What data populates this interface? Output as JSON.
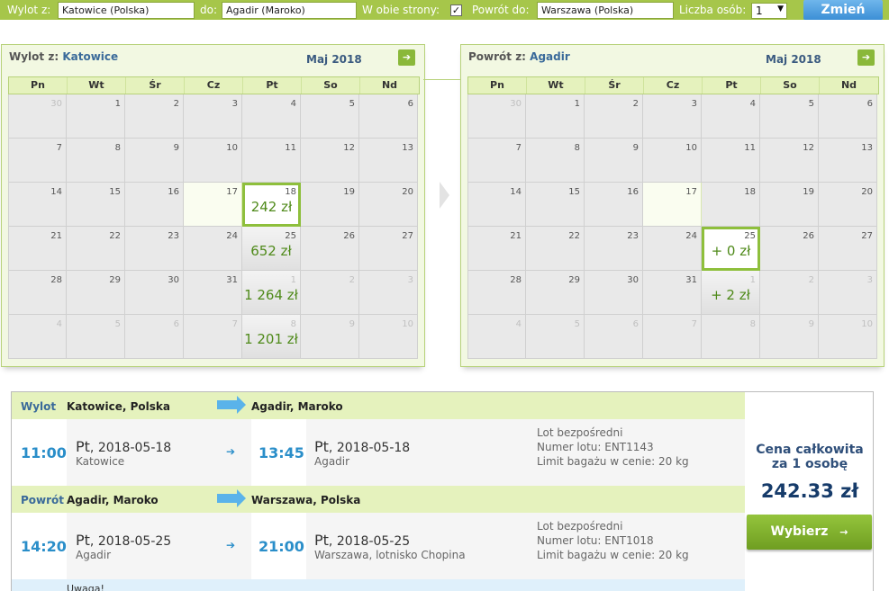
{
  "search": {
    "from_label": "Wylot z:",
    "from_value": "Katowice (Polska)",
    "to_label": "do:",
    "to_value": "Agadir (Maroko)",
    "roundtrip_label": "W obie strony:",
    "roundtrip_checked": "✓",
    "return_label": "Powrót do:",
    "return_value": "Warszawa (Polska)",
    "persons_label": "Liczba osób:",
    "persons_value": "1",
    "submit_label": "Zmień"
  },
  "weekdays": [
    "Pn",
    "Wt",
    "Śr",
    "Cz",
    "Pt",
    "So",
    "Nd"
  ],
  "outbound_calendar": {
    "title_prefix": "Wylot z:",
    "title_city": "Katowice",
    "month": "Maj 2018",
    "next_icon": "arrow-right-icon",
    "weeks": [
      [
        {
          "n": "30",
          "o": true
        },
        {
          "n": "1"
        },
        {
          "n": "2"
        },
        {
          "n": "3"
        },
        {
          "n": "4"
        },
        {
          "n": "5"
        },
        {
          "n": "6"
        }
      ],
      [
        {
          "n": "7"
        },
        {
          "n": "8"
        },
        {
          "n": "9"
        },
        {
          "n": "10"
        },
        {
          "n": "11"
        },
        {
          "n": "12"
        },
        {
          "n": "13"
        }
      ],
      [
        {
          "n": "14"
        },
        {
          "n": "15"
        },
        {
          "n": "16"
        },
        {
          "n": "17",
          "r": true
        },
        {
          "n": "18",
          "p": "242 zł",
          "s": true
        },
        {
          "n": "19"
        },
        {
          "n": "20"
        }
      ],
      [
        {
          "n": "21"
        },
        {
          "n": "22"
        },
        {
          "n": "23"
        },
        {
          "n": "24"
        },
        {
          "n": "25",
          "p": "652 zł"
        },
        {
          "n": "26"
        },
        {
          "n": "27"
        }
      ],
      [
        {
          "n": "28"
        },
        {
          "n": "29"
        },
        {
          "n": "30"
        },
        {
          "n": "31"
        },
        {
          "n": "1",
          "o": true,
          "p": "1 264 zł"
        },
        {
          "n": "2",
          "o": true
        },
        {
          "n": "3",
          "o": true
        }
      ],
      [
        {
          "n": "4",
          "o": true
        },
        {
          "n": "5",
          "o": true
        },
        {
          "n": "6",
          "o": true
        },
        {
          "n": "7",
          "o": true
        },
        {
          "n": "8",
          "o": true,
          "p": "1 201 zł"
        },
        {
          "n": "9",
          "o": true
        },
        {
          "n": "10",
          "o": true
        }
      ]
    ]
  },
  "return_calendar": {
    "title_prefix": "Powrót z:",
    "title_city": "Agadir",
    "month": "Maj 2018",
    "next_icon": "arrow-right-icon",
    "weeks": [
      [
        {
          "n": "30",
          "o": true
        },
        {
          "n": "1"
        },
        {
          "n": "2"
        },
        {
          "n": "3"
        },
        {
          "n": "4"
        },
        {
          "n": "5"
        },
        {
          "n": "6"
        }
      ],
      [
        {
          "n": "7"
        },
        {
          "n": "8"
        },
        {
          "n": "9"
        },
        {
          "n": "10"
        },
        {
          "n": "11"
        },
        {
          "n": "12"
        },
        {
          "n": "13"
        }
      ],
      [
        {
          "n": "14"
        },
        {
          "n": "15"
        },
        {
          "n": "16"
        },
        {
          "n": "17",
          "r": true
        },
        {
          "n": "18"
        },
        {
          "n": "19"
        },
        {
          "n": "20"
        }
      ],
      [
        {
          "n": "21"
        },
        {
          "n": "22"
        },
        {
          "n": "23"
        },
        {
          "n": "24"
        },
        {
          "n": "25",
          "p": "+ 0 zł",
          "s": true
        },
        {
          "n": "26"
        },
        {
          "n": "27"
        }
      ],
      [
        {
          "n": "28"
        },
        {
          "n": "29"
        },
        {
          "n": "30"
        },
        {
          "n": "31"
        },
        {
          "n": "1",
          "o": true,
          "p": "+ 2 zł"
        },
        {
          "n": "2",
          "o": true
        },
        {
          "n": "3",
          "o": true
        }
      ],
      [
        {
          "n": "4",
          "o": true
        },
        {
          "n": "5",
          "o": true
        },
        {
          "n": "6",
          "o": true
        },
        {
          "n": "7",
          "o": true
        },
        {
          "n": "8",
          "o": true
        },
        {
          "n": "9",
          "o": true
        },
        {
          "n": "10",
          "o": true
        }
      ]
    ]
  },
  "outbound": {
    "label": "Wylot",
    "from": "Katowice, Polska",
    "to": "Agadir, Maroko",
    "dep_time": "11:00",
    "dep_day": "Pt",
    "dep_date": ", 2018-05-18",
    "dep_city": "Katowice",
    "arr_time": "13:45",
    "arr_day": "Pt",
    "arr_date": ", 2018-05-18",
    "arr_city": "Agadir",
    "info1": "Lot bezpośredni",
    "info2": "Numer lotu: ENT1143",
    "info3": "Limit bagażu w cenie: 20 kg"
  },
  "return": {
    "label": "Powrót",
    "from": "Agadir, Maroko",
    "to": "Warszawa, Polska",
    "dep_time": "14:20",
    "dep_day": "Pt",
    "dep_date": ", 2018-05-25",
    "dep_city": "Agadir",
    "arr_time": "21:00",
    "arr_day": "Pt",
    "arr_date": ", 2018-05-25",
    "arr_city": "Warszawa, lotnisko Chopina",
    "info1": "Lot bezpośredni",
    "info2": "Numer lotu: ENT1018",
    "info3": "Limit bagażu w cenie: 20 kg"
  },
  "note": "Uwaga!",
  "total": {
    "title1": "Cena całkowita",
    "title2": "za 1 osobę",
    "amount": "242.33 zł",
    "button": "Wybierz",
    "button_arrow": "→"
  }
}
